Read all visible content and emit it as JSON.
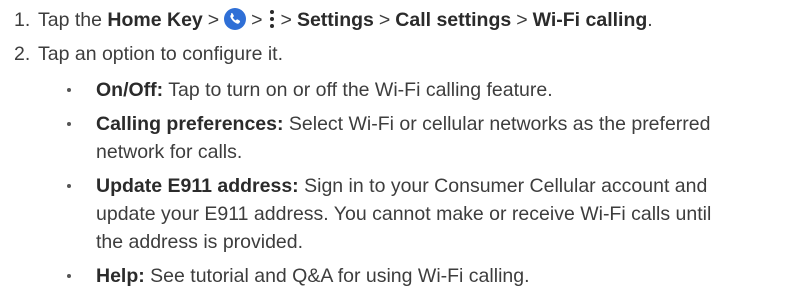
{
  "steps": [
    {
      "number": "1.",
      "parts": {
        "tap": "Tap the",
        "home_key": "Home Key",
        "sep1": ">",
        "sep2": ">",
        "sep3": ">",
        "settings": "Settings",
        "sep4": ">",
        "call_settings": "Call settings",
        "sep5": ">",
        "wifi_calling": "Wi-Fi calling",
        "end": "."
      },
      "icons": [
        "phone-app-icon",
        "more-options-icon"
      ]
    },
    {
      "number": "2.",
      "text": "Tap an option to configure it."
    }
  ],
  "options": [
    {
      "label": "On/Off:",
      "lines": [
        "Tap to turn on or off the Wi-Fi calling feature."
      ]
    },
    {
      "label": "Calling preferences:",
      "lines": [
        "Select Wi-Fi or cellular networks as the preferred",
        "network for calls."
      ]
    },
    {
      "label": "Update E911 address:",
      "lines": [
        "Sign in to your Consumer Cellular account and",
        "update your E911 address. You cannot make or receive Wi-Fi calls until",
        "the address is provided."
      ]
    },
    {
      "label": "Help:",
      "lines": [
        "See tutorial and Q&A for using Wi-Fi calling."
      ]
    }
  ],
  "colors": {
    "text": "#3d3d3d",
    "phone_icon_bg": "#2f6fd6"
  }
}
